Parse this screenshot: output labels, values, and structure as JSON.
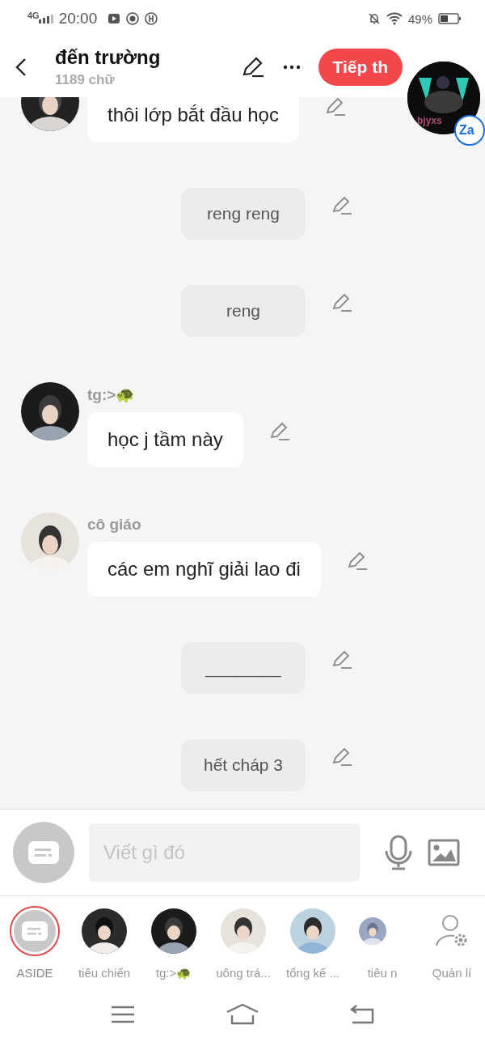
{
  "status_bar": {
    "network": "4G",
    "time": "20:00",
    "battery": "49%"
  },
  "header": {
    "title": "đến trường",
    "subtitle": "1189 chữ",
    "next_button": "Tiếp th"
  },
  "floating_bubble": {
    "label": "bjyxs",
    "badge": "Za"
  },
  "messages": [
    {
      "kind": "left",
      "text": "thôi lớp bắt đầu học"
    },
    {
      "kind": "narration",
      "text": "reng reng"
    },
    {
      "kind": "narration",
      "text": "reng"
    },
    {
      "kind": "left",
      "name": "tg:>🐢",
      "text": "học j tầm này"
    },
    {
      "kind": "left",
      "name": "cô giáo",
      "text": "các em nghĩ giải lao đi"
    },
    {
      "kind": "narration",
      "text": "________"
    },
    {
      "kind": "narration",
      "text": "hết cháp 3"
    }
  ],
  "composer": {
    "placeholder": "Viết gì đó"
  },
  "characters": [
    {
      "kind": "aside",
      "label": "ASIDE",
      "selected": true
    },
    {
      "kind": "person",
      "label": "tiêu chiến",
      "selected": false
    },
    {
      "kind": "person",
      "label": "tg:>🐢",
      "selected": false
    },
    {
      "kind": "person",
      "label": "uông trá...",
      "selected": false
    },
    {
      "kind": "person",
      "label": "tổng kế ...",
      "selected": false
    },
    {
      "kind": "person",
      "label": "tiêu n",
      "selected": false
    },
    {
      "kind": "manage",
      "label": "Quản lí",
      "selected": false
    }
  ]
}
